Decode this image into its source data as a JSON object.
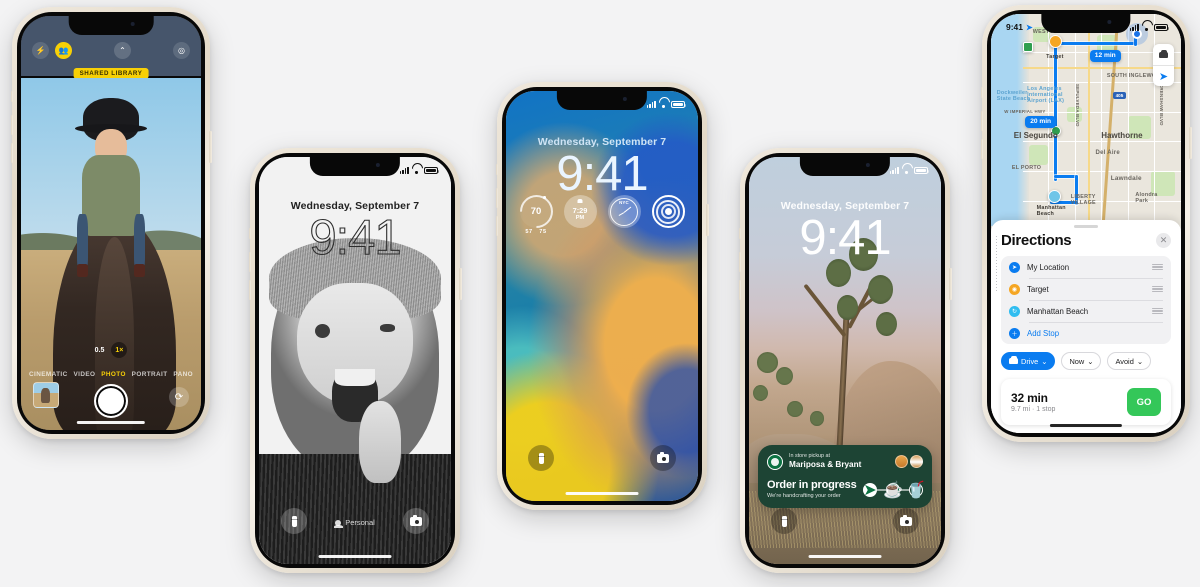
{
  "page": {
    "background_color": "#f3f3f4",
    "device_count": 5
  },
  "phone1": {
    "name": "camera-app",
    "camera": {
      "flash_icon": "flash-icon",
      "shared_library_icon": "shared-library-people-icon",
      "chevron_icon": "chevron-up-icon",
      "filters_icon": "filters-icon",
      "shared_library_badge": "SHARED LIBRARY",
      "zoom_options": [
        "0.5",
        "1×"
      ],
      "zoom_selected": "1×",
      "modes": [
        "CINEMATIC",
        "VIDEO",
        "PHOTO",
        "PORTRAIT",
        "PANO"
      ],
      "mode_selected": "PHOTO",
      "shutter_label": "shutter-button",
      "thumbnail_label": "photo-thumbnail",
      "flip_label": "flip-camera-button",
      "accent_color": "#f7d006"
    }
  },
  "phone2": {
    "name": "lock-screen-portrait",
    "status": {
      "signal": "signal-icon",
      "wifi": "wifi-icon",
      "battery": "battery-icon"
    },
    "date": "Wednesday, September 7",
    "time": "9:41",
    "focus_label": "Personal",
    "flashlight": "flashlight-button",
    "camera": "camera-button"
  },
  "phone3": {
    "name": "lock-screen-widgets",
    "date": "Wednesday, September 7",
    "time": "9:41",
    "widgets": [
      {
        "type": "weather",
        "temp": "70",
        "low": "57",
        "high": "75"
      },
      {
        "type": "alarm",
        "time": "7:29",
        "period": "PM"
      },
      {
        "type": "world-clock",
        "label": "NYC"
      },
      {
        "type": "activity-rings",
        "label": "Fitness"
      }
    ],
    "flashlight": "flashlight-button",
    "camera": "camera-button"
  },
  "phone4": {
    "name": "lock-screen-live-activity",
    "date": "Wednesday, September 7",
    "time": "9:41",
    "live_activity": {
      "brand": "Starbucks",
      "pickup_label": "In store pickup at",
      "store": "Mariposa & Bryant",
      "status_title": "Order in progress",
      "status_sub": "We're handcrafting your order",
      "items": [
        "food-item-icon",
        "drink-item-icon"
      ],
      "steps": [
        "order-sent",
        "barista-preparing",
        "ready-for-pickup"
      ],
      "card_color": "#1d4434"
    },
    "flashlight": "flashlight-button",
    "camera": "camera-button"
  },
  "phone5": {
    "name": "maps-directions",
    "status": {
      "time": "9:41",
      "location_arrow": "location-arrow-icon"
    },
    "map": {
      "eta_pills": [
        "12 min",
        "20 min"
      ],
      "labels": [
        "WESTCHESTER",
        "Target",
        "SOUTH INGLEWOOD",
        "Dockweiler State Beach",
        "Los Angeles International Airport (LAX)",
        "W IMPERIAL HWY",
        "El Segundo",
        "Hawthorne",
        "Del Aire",
        "EL PORTO",
        "Lawndale",
        "LIBERTY VILLAGE",
        "Alondra Park",
        "Manhattan Beach",
        "SEPULVEDA BLVD",
        "CRENSHAW BLVD",
        "405"
      ],
      "controls": [
        "car-mode-icon",
        "locate-me-icon"
      ]
    },
    "sheet": {
      "title": "Directions",
      "close": "close-icon",
      "stops": [
        {
          "label": "My Location",
          "icon": "location-arrow-icon"
        },
        {
          "label": "Target",
          "icon": "destination-pin-icon"
        },
        {
          "label": "Manhattan Beach",
          "icon": "transit-icon"
        }
      ],
      "add_stop": "Add Stop",
      "chips": [
        {
          "label": "Drive",
          "icon": "car-icon",
          "selected": true
        },
        {
          "label": "Now",
          "icon": "chevron-down-icon",
          "selected": false
        },
        {
          "label": "Avoid",
          "icon": "chevron-down-icon",
          "selected": false
        }
      ],
      "route": {
        "duration": "32 min",
        "details": "9.7 mi · 1 stop",
        "go_label": "GO",
        "go_color": "#34c759"
      }
    }
  }
}
